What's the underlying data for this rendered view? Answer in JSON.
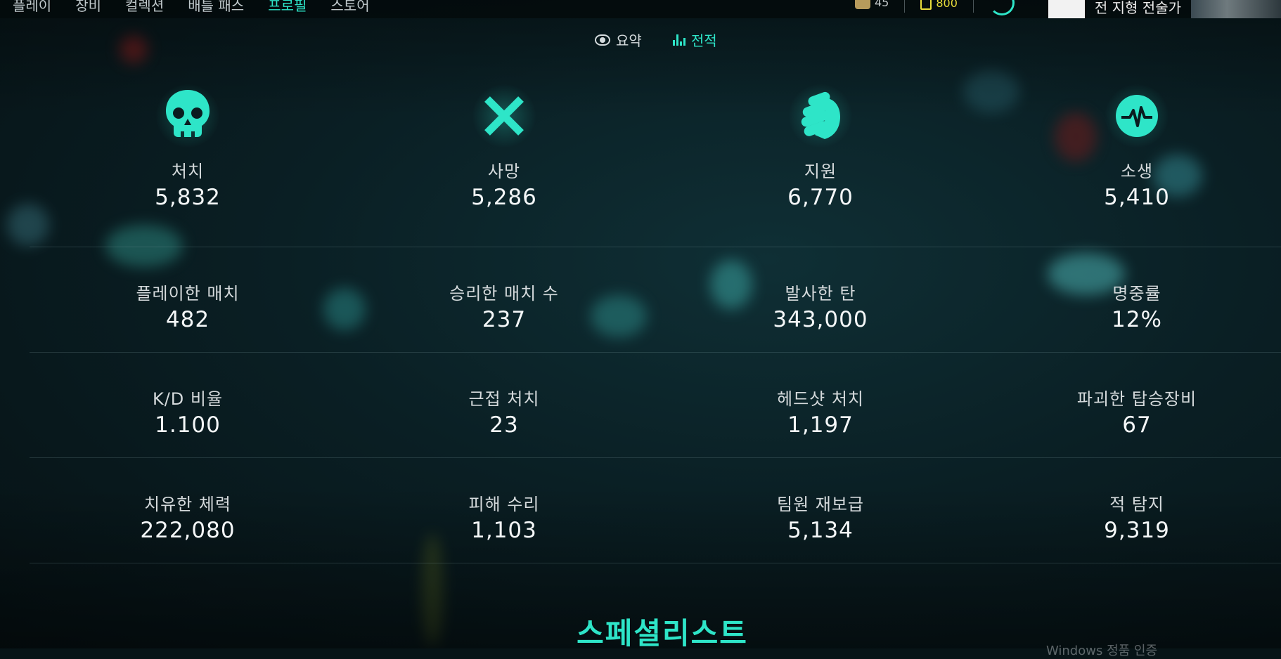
{
  "nav": {
    "items": [
      {
        "label": "플레이"
      },
      {
        "label": "장비"
      },
      {
        "label": "컬렉션"
      },
      {
        "label": "배틀 패스"
      },
      {
        "label": "프로필",
        "active": true
      },
      {
        "label": "스토어"
      }
    ]
  },
  "currency": {
    "tokens": "45",
    "gold": "800"
  },
  "profile": {
    "title": "전 지형 전술가"
  },
  "subtabs": [
    {
      "label": "요약",
      "icon": "eye-icon"
    },
    {
      "label": "전적",
      "icon": "bar-chart-icon",
      "active": true
    }
  ],
  "stats": {
    "row0": [
      {
        "label": "처치",
        "value": "5,832",
        "icon": "skull-icon"
      },
      {
        "label": "사망",
        "value": "5,286",
        "icon": "cross-icon"
      },
      {
        "label": "지원",
        "value": "6,770",
        "icon": "fist-icon"
      },
      {
        "label": "소생",
        "value": "5,410",
        "icon": "heartbeat-icon"
      }
    ],
    "row1": [
      {
        "label": "플레이한 매치",
        "value": "482"
      },
      {
        "label": "승리한 매치 수",
        "value": "237"
      },
      {
        "label": "발사한 탄",
        "value": "343,000"
      },
      {
        "label": "명중률",
        "value": "12%"
      }
    ],
    "row2": [
      {
        "label": "K/D 비율",
        "value": "1.100"
      },
      {
        "label": "근접 처치",
        "value": "23"
      },
      {
        "label": "헤드샷 처치",
        "value": "1,197"
      },
      {
        "label": "파괴한 탑승장비",
        "value": "67"
      }
    ],
    "row3": [
      {
        "label": "치유한 체력",
        "value": "222,080"
      },
      {
        "label": "피해 수리",
        "value": "1,103"
      },
      {
        "label": "팀원 재보급",
        "value": "5,134"
      },
      {
        "label": "적 탐지",
        "value": "9,319"
      }
    ]
  },
  "section": {
    "title": "스페셜리스트"
  },
  "watermark": "Windows 정품 인증",
  "colors": {
    "accent": "#2ee5c8",
    "gold": "#e8dc3b",
    "background": "#071417"
  }
}
